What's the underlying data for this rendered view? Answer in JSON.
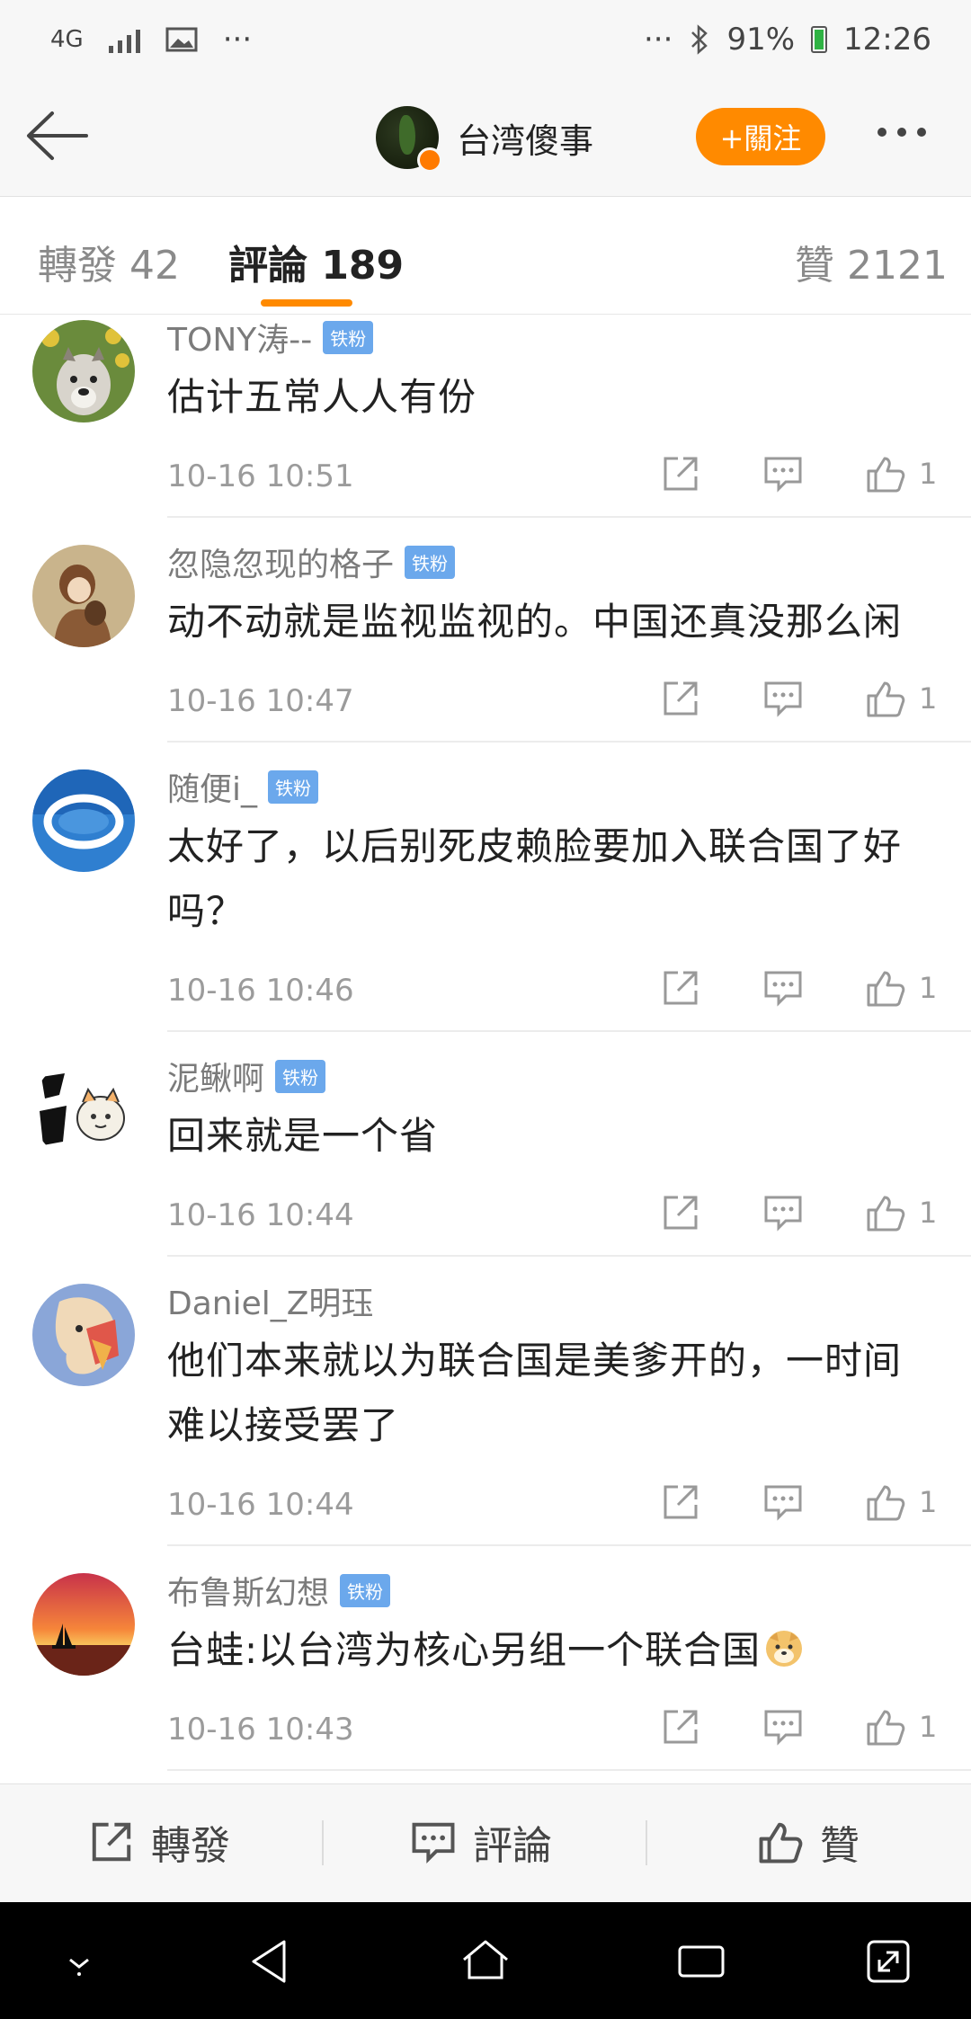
{
  "status_bar": {
    "network": "4G",
    "overflow": "···",
    "overflow_right": "···",
    "battery": "91%",
    "time": "12:26"
  },
  "header": {
    "back_icon": "arrow-left-icon",
    "title": "台湾傻事",
    "follow_label": "+關注",
    "more_icon": "more-dots-icon"
  },
  "tabs": [
    {
      "label": "轉發 42"
    },
    {
      "label": "評論 189",
      "active": true
    },
    {
      "label": "贊 2121"
    }
  ],
  "comments": [
    {
      "name": "TONY涛--",
      "badge": "铁粉",
      "text": "估计五常人人有份",
      "time": "10-16 10:51",
      "likes": "1",
      "avatar": "dog-avatar"
    },
    {
      "name": "忽隐忽现的格子",
      "badge": "铁粉",
      "text": "动不动就是监视监视的。中国还真没那么闲",
      "time": "10-16 10:47",
      "likes": "1",
      "avatar": "anime-couple-avatar"
    },
    {
      "name": "随便i_",
      "badge": "铁粉",
      "text": "太好了，以后别死皮赖脸要加入联合国了好吗？",
      "time": "10-16 10:46",
      "likes": "1",
      "avatar": "cloud-avatar"
    },
    {
      "name": "泥鳅啊",
      "badge": "铁粉",
      "text": "回来就是一个省",
      "time": "10-16 10:44",
      "likes": "1",
      "avatar": "lucky-cat-avatar"
    },
    {
      "name": "Daniel_Z明珏",
      "badge": "",
      "text": "他们本来就以为联合国是美爹开的，一时间难以接受罢了",
      "time": "10-16 10:44",
      "likes": "1",
      "avatar": "art-face-avatar"
    },
    {
      "name": "布鲁斯幻想",
      "badge": "铁粉",
      "text": "台蛙:以台湾为核心另组一个联合国",
      "time": "10-16 10:43",
      "likes": "1",
      "avatar": "sunset-avatar"
    }
  ],
  "bottom_bar": {
    "repost_label": "轉發",
    "comment_label": "評論",
    "like_label": "贊"
  },
  "colors": {
    "accent": "#ff8a00",
    "badge": "#6ba8ec",
    "meta_text": "#9b9b9b"
  }
}
